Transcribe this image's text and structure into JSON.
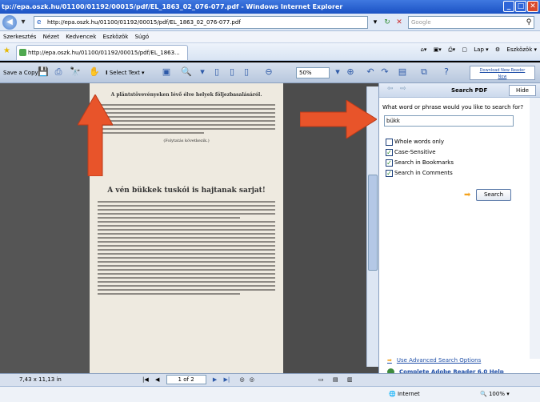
{
  "window": {
    "title": "tp://epa.oszk.hu/01100/01192/00015/pdf/EL_1863_02_076-077.pdf - Windows Internet Explorer",
    "min": "_",
    "max": "□",
    "close": "✕"
  },
  "address": {
    "url": "http://epa.oszk.hu/01100/01192/00015/pdf/EL_1863_02_076-077.pdf",
    "search_placeholder": "Google"
  },
  "menu": [
    "Szerkesztés",
    "Nézet",
    "Kedvencek",
    "Eszközök",
    "Súgó"
  ],
  "tab": {
    "label": "http://epa.oszk.hu/01100/01192/00015/pdf/EL_1863..."
  },
  "tools": {
    "lap": "Lap",
    "eszkozok": "Eszközök"
  },
  "reader": {
    "save_copy": "Save a Copy",
    "select_text": "Select Text",
    "zoom": "50%",
    "download_line1": "Download New Reader",
    "download_line2": "Now"
  },
  "document": {
    "heading1": "A pläntstövevényeken lévő élve helyek följezbasalásáról.",
    "signature": "(Folytatás következik.)",
    "heading2": "A vén bükkek tuskói is hajtanak sarjat!"
  },
  "search_panel": {
    "title": "Search PDF",
    "hide": "Hide",
    "prompt": "What word or phrase would you like to search for?",
    "query": "bükk",
    "options": [
      {
        "label": "Whole words only",
        "checked": false
      },
      {
        "label": "Case-Sensitive",
        "checked": true
      },
      {
        "label": "Search in Bookmarks",
        "checked": true
      },
      {
        "label": "Search in Comments",
        "checked": true
      }
    ],
    "search_button": "Search",
    "advanced_link": "Use Advanced Search Options",
    "help_link": "Complete Adobe Reader 6.0 Help"
  },
  "status": {
    "size": "7,43 x 11,13 in",
    "page": "1 of 2"
  },
  "ie_status": {
    "zone": "Internet",
    "zoom": "100%"
  },
  "colors": {
    "arrow": "#e8542a",
    "title_bar": "#1b52c4"
  }
}
